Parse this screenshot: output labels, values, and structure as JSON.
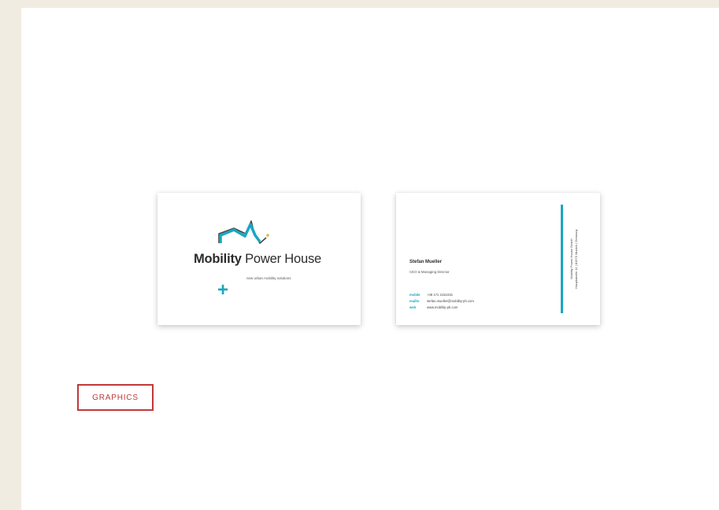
{
  "front_card": {
    "brand_bold": "Mobility",
    "brand_rest": " Power House",
    "tagline": "new urban mobility solutions",
    "plus_symbol": "+"
  },
  "back_card": {
    "name": "Stefan Mueller",
    "role": "CEO & Managing Director",
    "contacts": [
      {
        "label": "mobile",
        "value": "+49 171 2151015"
      },
      {
        "label": "mailto",
        "value": "stefan.mueller@mobility-ph.com"
      },
      {
        "label": "web",
        "value": "www.mobility-ph.com"
      }
    ],
    "address_line1": "Mobility Power House GmbH",
    "address_line2": "Hauptstraße 11 | 81579 Munich | Germany"
  },
  "graphics_label": "GRAPHICS",
  "colors": {
    "accent": "#1aa6c1",
    "badge": "#c0393b",
    "page_background": "#f1ece1",
    "sheet": "#ffffff"
  }
}
